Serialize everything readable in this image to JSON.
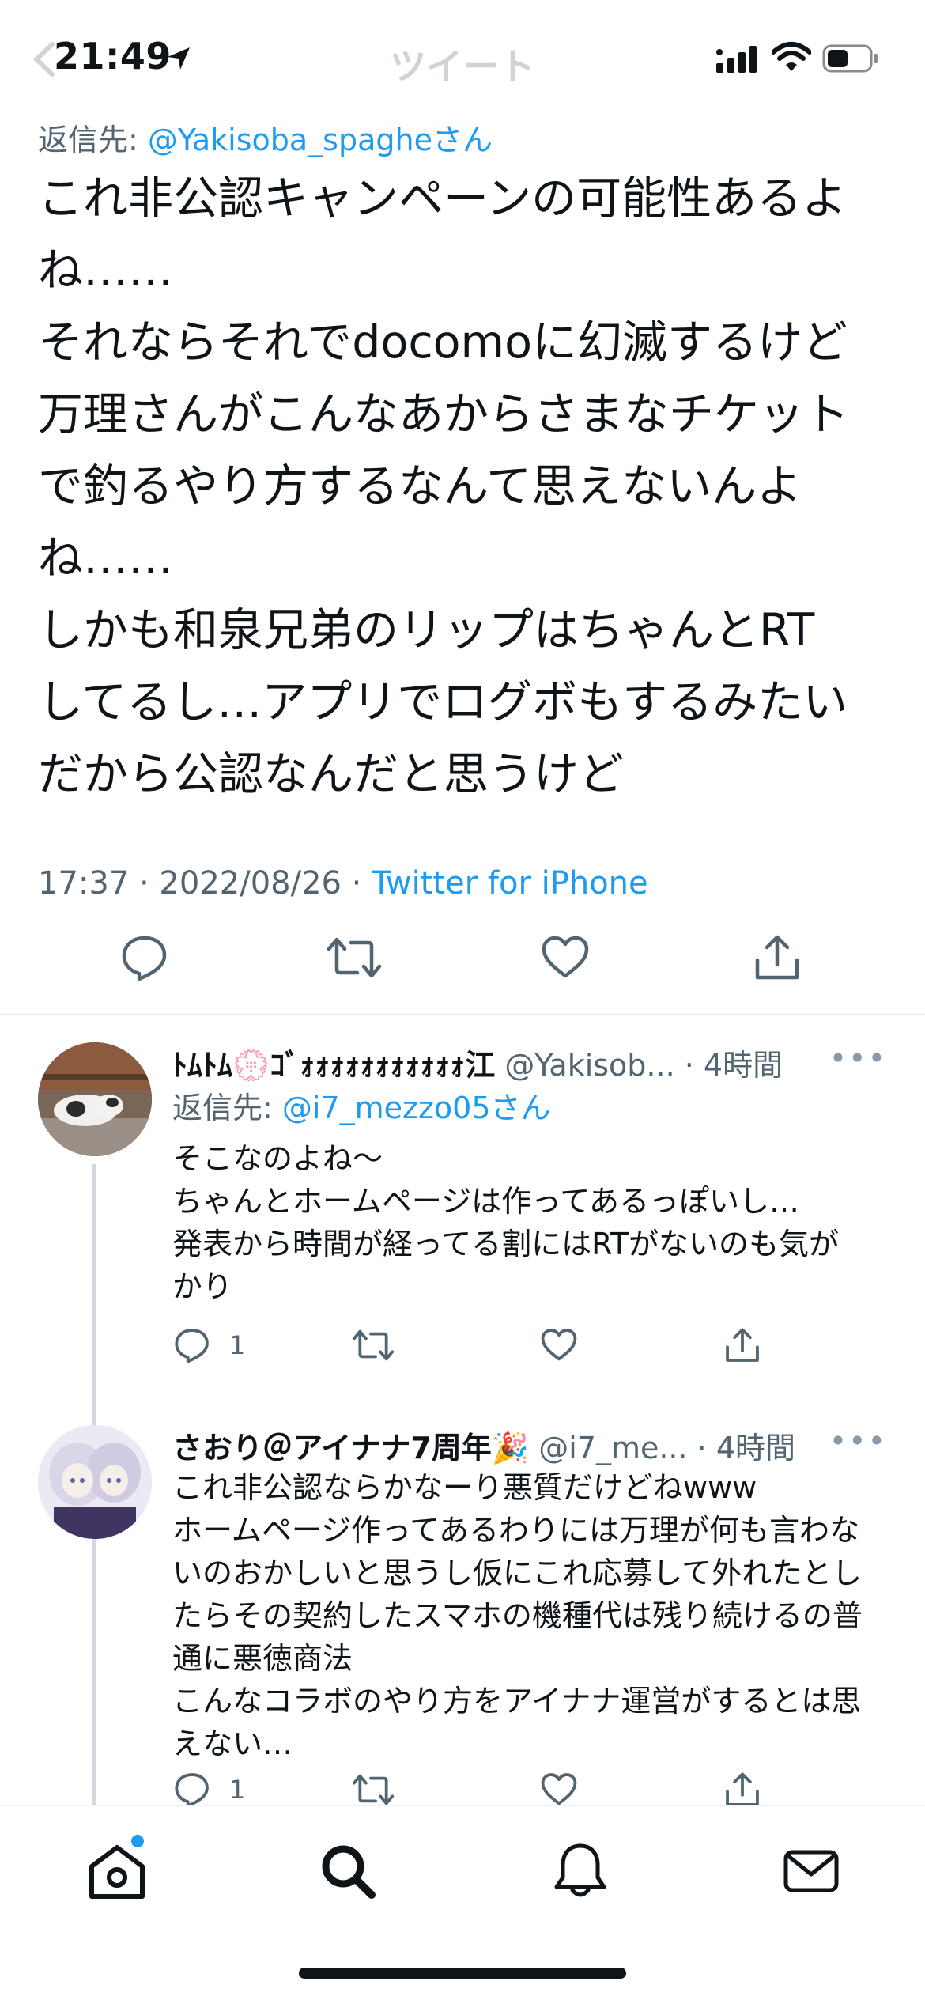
{
  "status_bar": {
    "time": "21:49"
  },
  "header": {
    "title": "ツイート"
  },
  "main_tweet": {
    "reply_to_prefix": "返信先: ",
    "reply_to_handle": "@Yakisoba_spaghe",
    "reply_to_suffix": "さん",
    "text": "これ非公認キャンペーンの可能性あるよ\nね……\nそれならそれでdocomoに幻滅するけど\n万理さんがこんなあからさまなチケット\nで釣るやり方するなんて思えないんよ\nね……\nしかも和泉兄弟のリップはちゃんとRT\nしてるし…アプリでログボもするみたい\nだから公認なんだと思うけど",
    "time_date": "17:37 · 2022/08/26 · ",
    "client": "Twitter for iPhone"
  },
  "replies": [
    {
      "name": "ﾄﾑﾄﾑ💮ｺﾞｫｫｫｫｫｫｫｫｫｫｫ江",
      "handle": "@Yakisob...",
      "time": "· 4時間",
      "more": "•••",
      "reply_to_prefix": "返信先: ",
      "reply_to_handle": "@i7_mezzo05",
      "reply_to_suffix": "さん",
      "text": "そこなのよね〜\nちゃんとホームページは作ってあるっぽいし…\n発表から時間が経ってる割にはRTがないのも気が\nかり",
      "reply_count": "1"
    },
    {
      "name": "さおり＠アイナナ7周年🎉",
      "handle": "@i7_me...",
      "time": "· 4時間",
      "more": "•••",
      "text": "これ非公認ならかなーり悪質だけどねwww\nホームページ作ってあるわりには万理が何も言わな\nいのおかしいと思うし仮にこれ応募して外れたとし\nたらその契約したスマホの機種代は残り続けるの普\n通に悪徳商法\nこんなコラボのやり方をアイナナ運営がするとは思\nえない…",
      "reply_count": "1"
    }
  ],
  "tab_bar": {
    "items": [
      "home-icon",
      "search-icon",
      "notifications-icon",
      "messages-icon"
    ]
  },
  "colors": {
    "accent": "#1d9bf0",
    "secondary_text": "#536471",
    "icon": "#536471"
  }
}
